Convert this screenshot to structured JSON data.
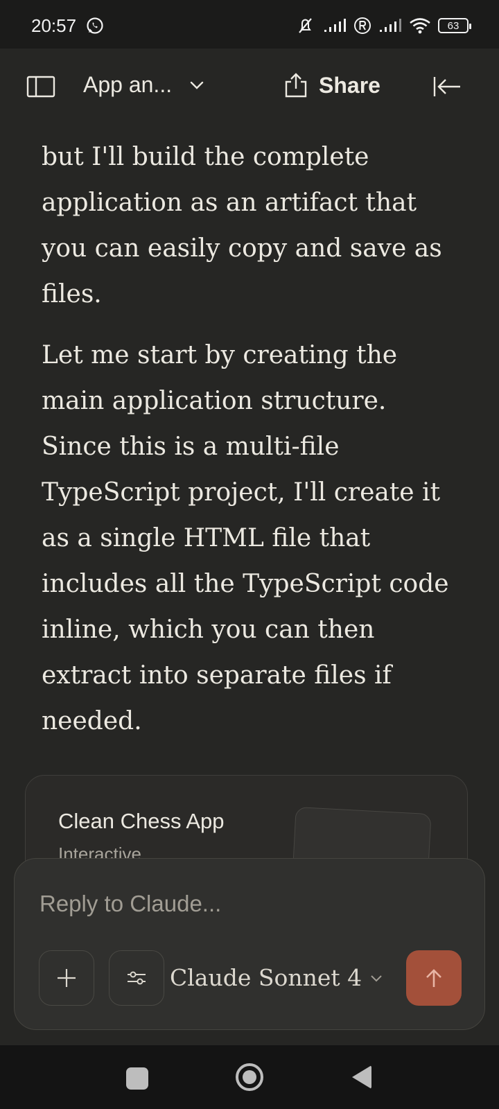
{
  "status_bar": {
    "time": "20:57",
    "battery": "63",
    "icons": [
      "whatsapp-icon",
      "mute-icon",
      "signal-icon",
      "roaming-icon",
      "wifi-icon",
      "battery-icon"
    ]
  },
  "header": {
    "title": "App an...",
    "share_label": "Share"
  },
  "message": {
    "paragraphs": [
      "but I'll build the complete application as an artifact that you can easily copy and save as files.",
      "Let me start by creating the main application structure. Since this is a multi-file TypeScript project, I'll create it as a single HTML file that includes all the TypeScript code inline, which you can then extract into separate files if needed."
    ]
  },
  "artifact": {
    "title": "Clean Chess App",
    "subtitle": "Interactive"
  },
  "composer": {
    "placeholder": "Reply to Claude...",
    "model": "Claude Sonnet 4"
  },
  "colors": {
    "background": "#262624",
    "accent": "#a3503a",
    "text": "#ece9e1"
  }
}
